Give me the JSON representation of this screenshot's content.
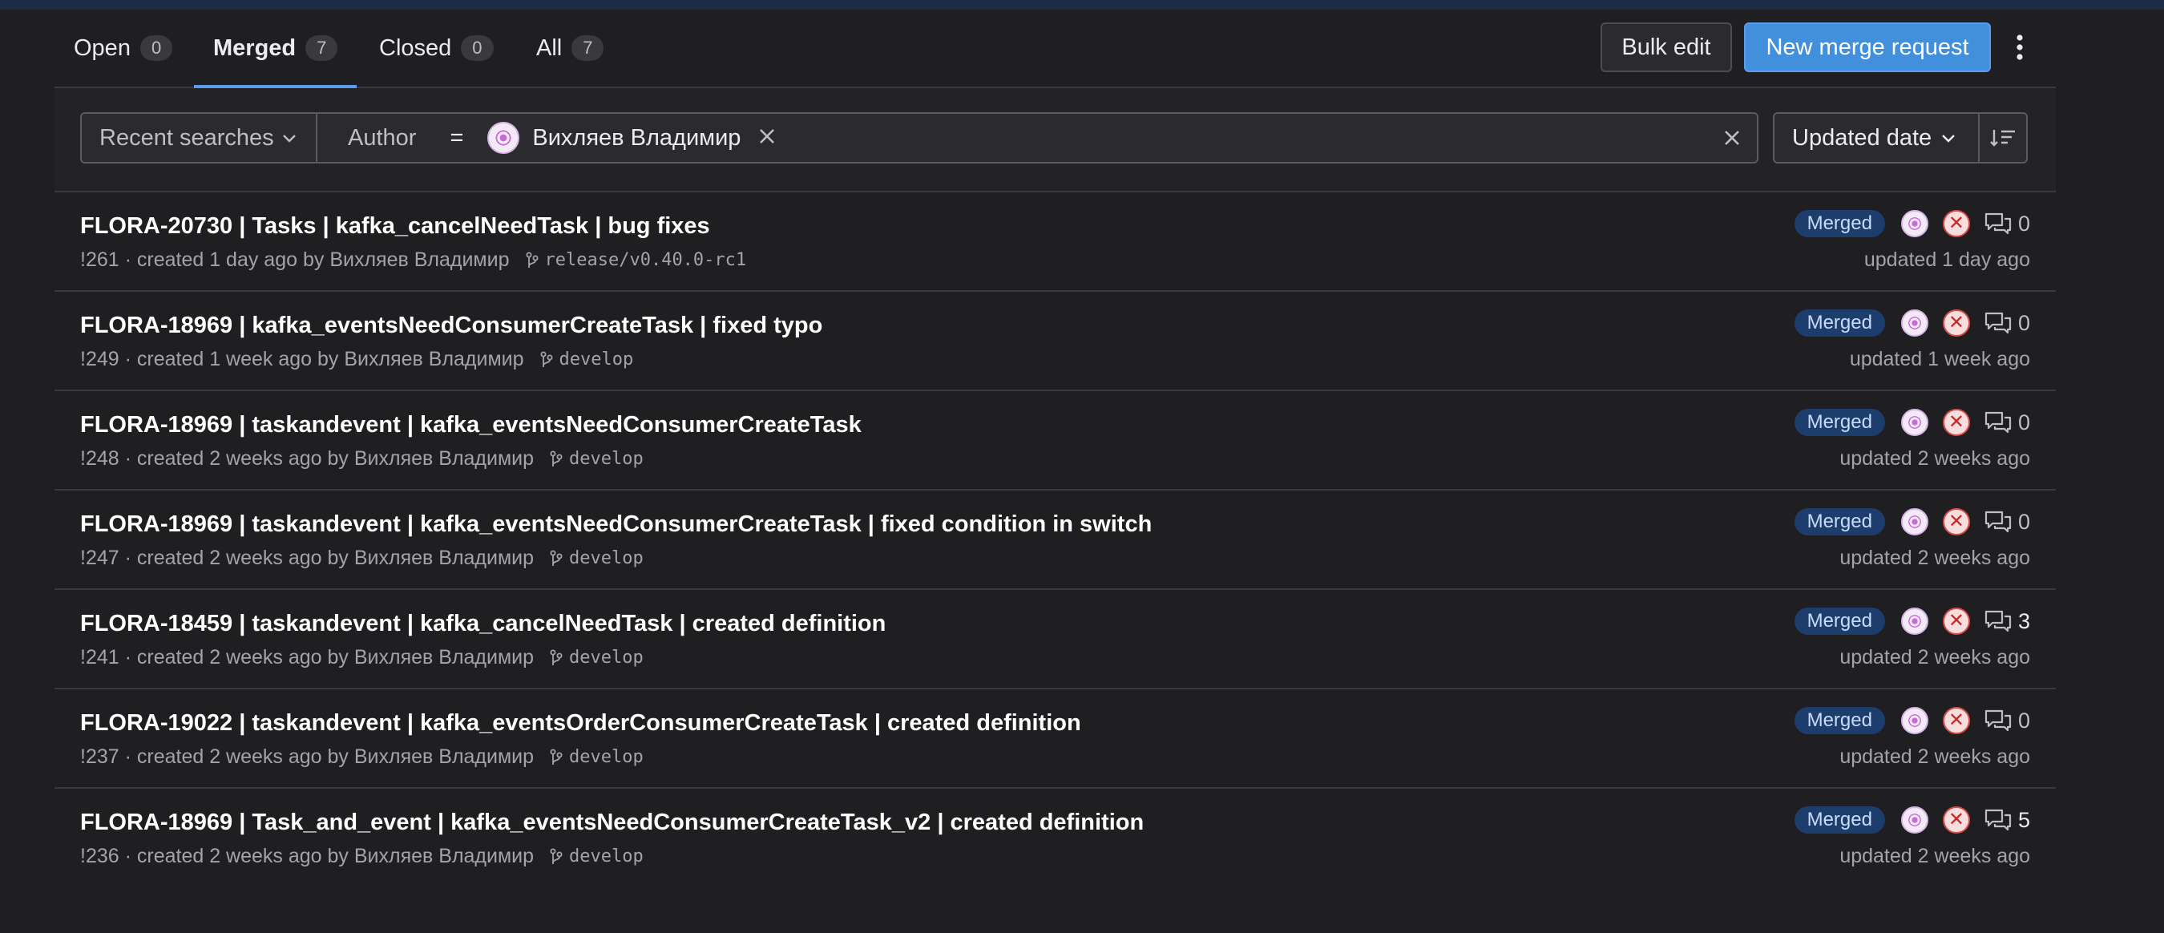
{
  "tabs": [
    {
      "label": "Open",
      "count": "0"
    },
    {
      "label": "Merged",
      "count": "7"
    },
    {
      "label": "Closed",
      "count": "0"
    },
    {
      "label": "All",
      "count": "7"
    }
  ],
  "actions": {
    "bulk_edit": "Bulk edit",
    "new_merge_request": "New merge request"
  },
  "filter": {
    "recent_searches": "Recent searches",
    "token_key": "Author",
    "token_operator": "=",
    "token_value": "Вихляев Владимир",
    "sort_label": "Updated date"
  },
  "merge_requests": [
    {
      "title": "FLORA-20730 | Tasks | kafka_cancelNeedTask | bug fixes",
      "meta": "!261 · created 1 day ago by Вихляев Владимир",
      "branch": "release/v0.40.0-rc1",
      "status": "Merged",
      "comments": "0",
      "updated": "updated 1 day ago"
    },
    {
      "title": "FLORA-18969 | kafka_eventsNeedConsumerCreateTask | fixed typo",
      "meta": "!249 · created 1 week ago by Вихляев Владимир",
      "branch": "develop",
      "status": "Merged",
      "comments": "0",
      "updated": "updated 1 week ago"
    },
    {
      "title": "FLORA-18969 | taskandevent | kafka_eventsNeedConsumerCreateTask",
      "meta": "!248 · created 2 weeks ago by Вихляев Владимир",
      "branch": "develop",
      "status": "Merged",
      "comments": "0",
      "updated": "updated 2 weeks ago"
    },
    {
      "title": "FLORA-18969 | taskandevent | kafka_eventsNeedConsumerCreateTask | fixed condition in switch",
      "meta": "!247 · created 2 weeks ago by Вихляев Владимир",
      "branch": "develop",
      "status": "Merged",
      "comments": "0",
      "updated": "updated 2 weeks ago"
    },
    {
      "title": "FLORA-18459 | taskandevent | kafka_cancelNeedTask | created definition",
      "meta": "!241 · created 2 weeks ago by Вихляев Владимир",
      "branch": "develop",
      "status": "Merged",
      "comments": "3",
      "updated": "updated 2 weeks ago"
    },
    {
      "title": "FLORA-19022 | taskandevent | kafka_eventsOrderConsumerCreateTask | created definition",
      "meta": "!237 · created 2 weeks ago by Вихляев Владимир",
      "branch": "develop",
      "status": "Merged",
      "comments": "0",
      "updated": "updated 2 weeks ago"
    },
    {
      "title": "FLORA-18969 | Task_and_event | kafka_eventsNeedConsumerCreateTask_v2 | created definition",
      "meta": "!236 · created 2 weeks ago by Вихляев Владимир",
      "branch": "develop",
      "status": "Merged",
      "comments": "5",
      "updated": "updated 2 weeks ago"
    }
  ]
}
